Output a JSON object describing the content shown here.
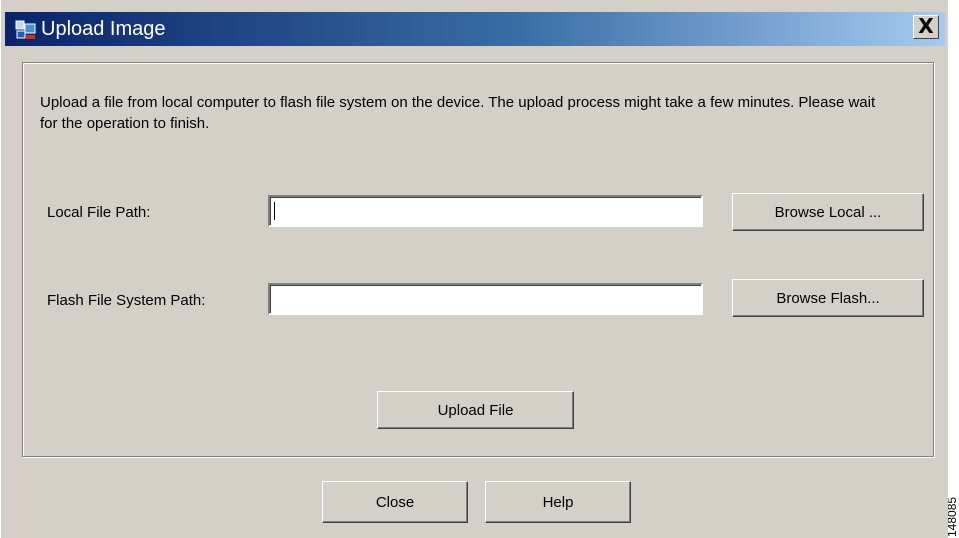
{
  "window": {
    "title": "Upload Image",
    "close_glyph": "X",
    "app_icon": "device-manager-icon"
  },
  "description": "Upload a file from local computer to flash file system on the device.  The upload process might take a few minutes.  Please wait for the operation to finish.",
  "form": {
    "local_label": "Local File Path:",
    "local_value": "",
    "flash_label": "Flash File System Path:",
    "flash_value": "",
    "browse_local": "Browse Local ...",
    "browse_flash": "Browse Flash...",
    "upload": "Upload File"
  },
  "footer": {
    "close": "Close",
    "help": "Help"
  },
  "side_id": "148085",
  "colors": {
    "title_start": "#0a246a",
    "title_end": "#a6caf0",
    "dialog_bg": "#d4d0c8"
  }
}
